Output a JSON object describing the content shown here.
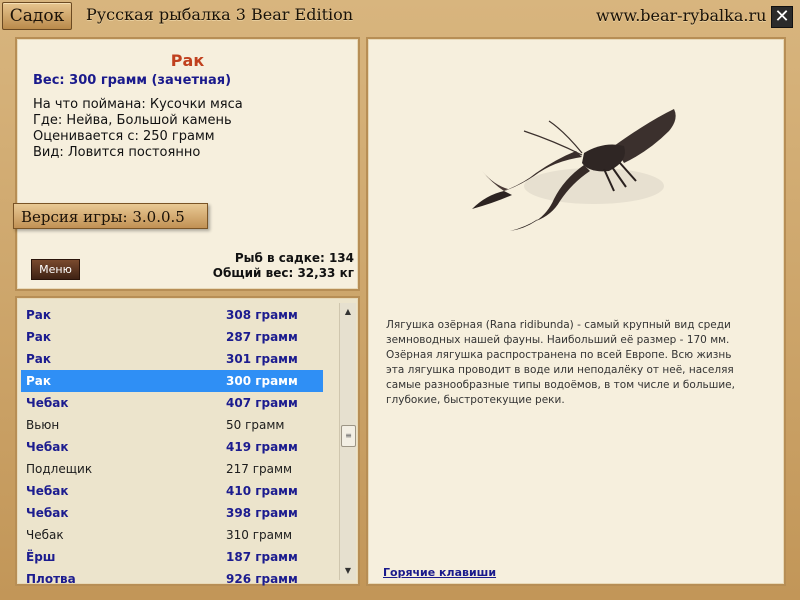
{
  "topbar": {
    "sadok_label": "Садок",
    "game_title": "Русская рыбалка 3 Bear Edition",
    "site": "www.bear-rybalka.ru",
    "close_glyph": "✕"
  },
  "info": {
    "name": "Рак",
    "weight_line": "Вес: 300 грамм (зачетная)",
    "caught_on": "На что поймана: Кусочки мяса",
    "where": "Где: Нейва, Большой камень",
    "rated_from": "Оценивается с: 250 грамм",
    "kind": "Вид: Ловится постоянно",
    "version": "Версия игры: 3.0.0.5",
    "menu_label": "Меню",
    "fish_count": "Рыб в садке: 134",
    "total_weight": "Общий вес: 32,33 кг"
  },
  "list": {
    "rows": [
      {
        "name": "Рак",
        "weight": "308 грамм",
        "style": "bold"
      },
      {
        "name": "Рак",
        "weight": "287 грамм",
        "style": "bold"
      },
      {
        "name": "Рак",
        "weight": "301 грамм",
        "style": "bold"
      },
      {
        "name": "Рак",
        "weight": "300 грамм",
        "style": "selected"
      },
      {
        "name": "Чебак",
        "weight": "407 грамм",
        "style": "bold"
      },
      {
        "name": "Вьюн",
        "weight": "50 грамм",
        "style": "normal"
      },
      {
        "name": "Чебак",
        "weight": "419 грамм",
        "style": "bold"
      },
      {
        "name": "Подлещик",
        "weight": "217 грамм",
        "style": "normal"
      },
      {
        "name": "Чебак",
        "weight": "410 грамм",
        "style": "bold"
      },
      {
        "name": "Чебак",
        "weight": "398 грамм",
        "style": "bold"
      },
      {
        "name": "Чебак",
        "weight": "310 грамм",
        "style": "normal"
      },
      {
        "name": "Ёрш",
        "weight": "187 грамм",
        "style": "bold"
      },
      {
        "name": "Плотва",
        "weight": "926 грамм",
        "style": "bold"
      }
    ]
  },
  "detail": {
    "description": "Лягушка озёрная (Rana ridibunda) - самый крупный вид среди земноводных нашей фауны. Наибольший её размер - 170 мм. Озёрная лягушка распространена по всей Европе.  Всю жизнь эта лягушка проводит в воде или неподалёку от неё, населяя самые разнообразные типы водоёмов, в том числе и большие, глубокие, быстротекущие реки.",
    "hotkeys": "Горячие клавиши",
    "image": "crayfish-illustration"
  }
}
